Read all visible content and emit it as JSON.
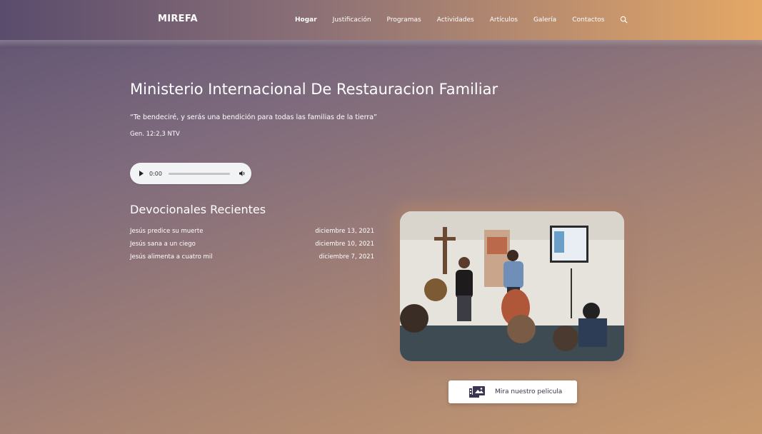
{
  "site": {
    "logo": "MIREFA"
  },
  "nav": {
    "items": [
      "Hogar",
      "Justificación",
      "Programas",
      "Actividades",
      "Artículos",
      "Galería",
      "Contactos"
    ],
    "search_icon": "search-icon"
  },
  "hero": {
    "title": "Ministerio Internacional De Restauracion Familiar",
    "quote": "“Te bendeciré, y serás una bendición para todas las familias de la tierra”",
    "reference": "Gen. 12:2,3 NTV"
  },
  "audio": {
    "time": "0:00",
    "progress": 0
  },
  "devotionals": {
    "heading": "Devocionales Recientes",
    "items": [
      {
        "title": "Jesús predice su muerte",
        "date": "diciembre 13, 2021"
      },
      {
        "title": "Jesús sana a un ciego",
        "date": "diciembre 10, 2021"
      },
      {
        "title": "Jesús alimenta a cuatro mil",
        "date": "diciembre 7, 2021"
      }
    ]
  },
  "movie_button": {
    "label": "Mira nuestro pelicula",
    "icon": "video-gallery-icon"
  },
  "colors": {
    "button_text": "#3a3550",
    "header_left": "#5a4c6d",
    "header_right": "#e4a866"
  }
}
